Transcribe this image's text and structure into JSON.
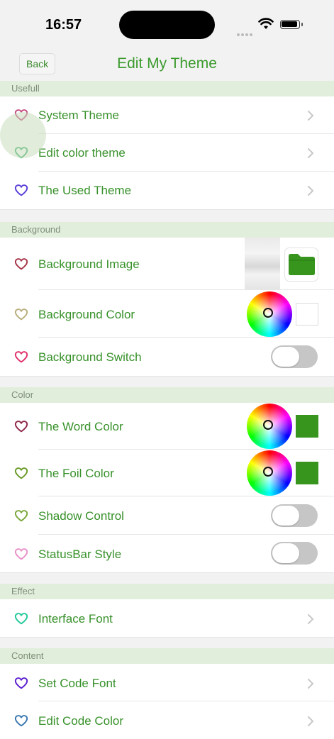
{
  "status_bar": {
    "time": "16:57"
  },
  "nav": {
    "back_label": "Back",
    "title": "Edit My Theme"
  },
  "colors": {
    "accent": "#37912a",
    "header_bg": "#e2eedc",
    "swatch_green": "#37951e"
  },
  "sections": {
    "usefull": {
      "header": "Usefull",
      "rows": [
        {
          "label": "System Theme",
          "icon": "heart-icon",
          "icon_color": "#c54a80",
          "accessory": "chevron"
        },
        {
          "label": "Edit color theme",
          "icon": "heart-icon",
          "icon_color": "#3ab06c",
          "accessory": "chevron"
        },
        {
          "label": "The Used Theme",
          "icon": "heart-icon",
          "icon_color": "#5a3ed8",
          "accessory": "chevron"
        }
      ]
    },
    "background": {
      "header": "Background",
      "rows": [
        {
          "label": "Background Image",
          "icon": "heart-icon",
          "icon_color": "#a53548",
          "accessory": "image-and-folder"
        },
        {
          "label": "Background Color",
          "icon": "heart-icon",
          "icon_color": "#b8ae7c",
          "accessory": "color-wheel",
          "swatch_color": "#ffffff"
        },
        {
          "label": "Background Switch",
          "icon": "heart-icon",
          "icon_color": "#e0306e",
          "accessory": "toggle",
          "on": false
        }
      ]
    },
    "color": {
      "header": "Color",
      "rows": [
        {
          "label": "The Word Color",
          "icon": "heart-icon",
          "icon_color": "#8e2848",
          "accessory": "color-wheel",
          "swatch_color": "#37951e"
        },
        {
          "label": "The Foil Color",
          "icon": "heart-icon",
          "icon_color": "#6a9a28",
          "accessory": "color-wheel",
          "swatch_color": "#37951e"
        },
        {
          "label": "Shadow Control",
          "icon": "heart-icon",
          "icon_color": "#7aa83a",
          "accessory": "toggle",
          "on": false
        },
        {
          "label": "StatusBar Style",
          "icon": "heart-icon",
          "icon_color": "#e890c8",
          "accessory": "toggle",
          "on": false
        }
      ]
    },
    "effect": {
      "header": "Effect",
      "rows": [
        {
          "label": "Interface Font",
          "icon": "heart-icon",
          "icon_color": "#22c89a",
          "accessory": "chevron"
        }
      ]
    },
    "content": {
      "header": "Content",
      "rows": [
        {
          "label": "Set Code Font",
          "icon": "heart-icon",
          "icon_color": "#5a1ed0",
          "accessory": "chevron"
        },
        {
          "label": "Edit Code Color",
          "icon": "heart-icon",
          "icon_color": "#3a78b0",
          "accessory": "chevron"
        }
      ]
    }
  }
}
